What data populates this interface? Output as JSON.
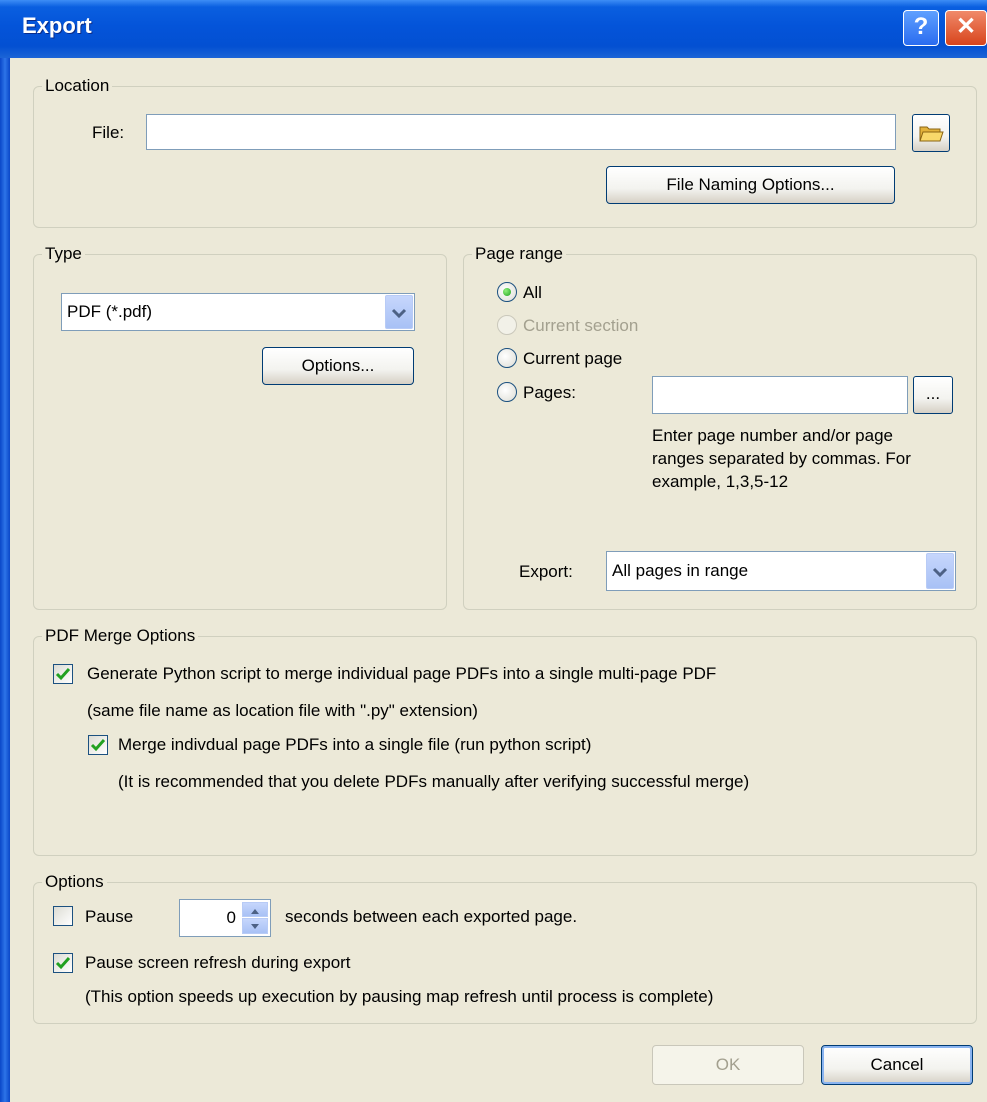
{
  "window": {
    "title": "Export",
    "help_glyph": "?",
    "close_glyph": "✕"
  },
  "location": {
    "legend": "Location",
    "file_label": "File:",
    "file_value": "",
    "browse_icon": "open-folder-icon",
    "file_naming_button": "File Naming Options..."
  },
  "type": {
    "legend": "Type",
    "selected": "PDF (*.pdf)",
    "options_button": "Options..."
  },
  "page_range": {
    "legend": "Page range",
    "options": [
      {
        "label": "All",
        "selected": true,
        "enabled": true
      },
      {
        "label": "Current section",
        "selected": false,
        "enabled": false
      },
      {
        "label": "Current page",
        "selected": false,
        "enabled": true
      },
      {
        "label": "Pages:",
        "selected": false,
        "enabled": true
      }
    ],
    "pages_value": "",
    "ellipsis_button": "...",
    "help_text": "Enter page number and/or page ranges separated by commas.  For example, 1,3,5-12",
    "export_label": "Export:",
    "export_selected": "All pages in range"
  },
  "pdf_merge": {
    "legend": "PDF Merge Options",
    "generate_script_label": "Generate Python script to merge individual page PDFs into a single multi-page PDF",
    "generate_script_checked": true,
    "generate_script_note": "(same file name as location file with \".py\" extension)",
    "merge_label": "Merge indivdual page PDFs into a single file (run python script)",
    "merge_checked": true,
    "merge_note": "(It is recommended that you delete PDFs manually after verifying successful merge)"
  },
  "options": {
    "legend": "Options",
    "pause_label": "Pause",
    "pause_checked": false,
    "pause_seconds": "0",
    "seconds_label": "seconds between each exported page.",
    "refresh_label": "Pause screen refresh during export",
    "refresh_checked": true,
    "refresh_note": "(This option speeds up execution by pausing map refresh until process is complete)"
  },
  "buttons": {
    "ok": "OK",
    "cancel": "Cancel"
  },
  "colors": {
    "titlebar": "#0454d9",
    "dialog_bg": "#ece9d8",
    "check_green": "#21a121"
  }
}
